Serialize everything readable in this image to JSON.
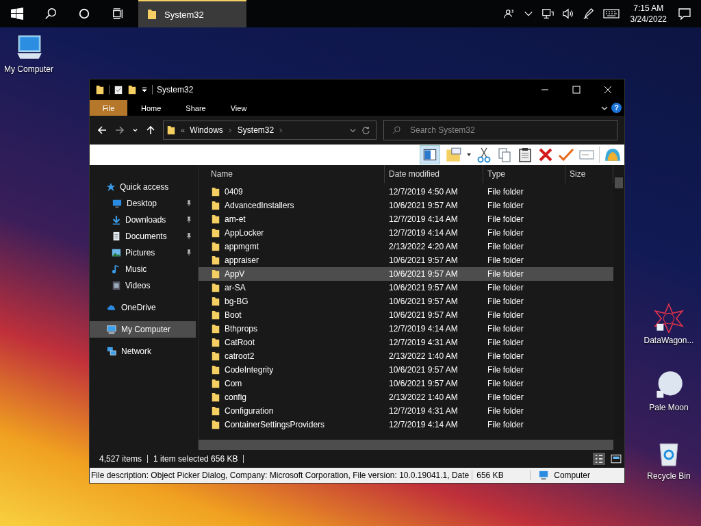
{
  "taskbar": {
    "window_button": {
      "label": "System32",
      "selected": true
    },
    "time": "7:15 AM",
    "date": "3/24/2022"
  },
  "desktop_icons": [
    {
      "label": "My Computer",
      "kind": "computer"
    },
    {
      "label": "DataWagon...",
      "kind": "star"
    },
    {
      "label": "Pale Moon",
      "kind": "moon"
    },
    {
      "label": "Recycle Bin",
      "kind": "bin"
    }
  ],
  "window": {
    "title": "System32",
    "ribbon_tabs": [
      {
        "label": "File",
        "kind": "file"
      },
      {
        "label": "Home",
        "kind": "tab"
      },
      {
        "label": "Share",
        "kind": "tab"
      },
      {
        "label": "View",
        "kind": "tab"
      }
    ],
    "help": "?",
    "address": {
      "overflow": "«",
      "crumbs": [
        "Windows",
        "System32"
      ]
    },
    "search": {
      "placeholder": "Search System32"
    },
    "nav_pane": [
      {
        "label": "Quick access",
        "kind": "star",
        "selected": false,
        "children": [
          {
            "label": "Desktop",
            "kind": "desktop",
            "pinned": true,
            "selected": false
          },
          {
            "label": "Downloads",
            "kind": "download",
            "pinned": true,
            "selected": false
          },
          {
            "label": "Documents",
            "kind": "document",
            "pinned": true,
            "selected": false
          },
          {
            "label": "Pictures",
            "kind": "picture",
            "pinned": true,
            "selected": false
          },
          {
            "label": "Music",
            "kind": "music",
            "pinned": false,
            "selected": false
          },
          {
            "label": "Videos",
            "kind": "video",
            "pinned": false,
            "selected": false
          }
        ]
      },
      {
        "label": "OneDrive",
        "kind": "cloud",
        "selected": false
      },
      {
        "label": "My Computer",
        "kind": "computer",
        "selected": true
      },
      {
        "label": "Network",
        "kind": "network",
        "selected": false
      }
    ],
    "columns": [
      "Name",
      "Date modified",
      "Type",
      "Size"
    ],
    "rows": [
      {
        "name": "0409",
        "date": "12/7/2019 4:50 AM",
        "type": "File folder",
        "selected": false
      },
      {
        "name": "AdvancedInstallers",
        "date": "10/6/2021 9:57 AM",
        "type": "File folder",
        "selected": false
      },
      {
        "name": "am-et",
        "date": "12/7/2019 4:14 AM",
        "type": "File folder",
        "selected": false
      },
      {
        "name": "AppLocker",
        "date": "12/7/2019 4:14 AM",
        "type": "File folder",
        "selected": false
      },
      {
        "name": "appmgmt",
        "date": "2/13/2022 4:20 AM",
        "type": "File folder",
        "selected": false
      },
      {
        "name": "appraiser",
        "date": "10/6/2021 9:57 AM",
        "type": "File folder",
        "selected": false
      },
      {
        "name": "AppV",
        "date": "10/6/2021 9:57 AM",
        "type": "File folder",
        "selected": true
      },
      {
        "name": "ar-SA",
        "date": "10/6/2021 9:57 AM",
        "type": "File folder",
        "selected": false
      },
      {
        "name": "bg-BG",
        "date": "10/6/2021 9:57 AM",
        "type": "File folder",
        "selected": false
      },
      {
        "name": "Boot",
        "date": "10/6/2021 9:57 AM",
        "type": "File folder",
        "selected": false
      },
      {
        "name": "Bthprops",
        "date": "12/7/2019 4:14 AM",
        "type": "File folder",
        "selected": false
      },
      {
        "name": "CatRoot",
        "date": "12/7/2019 4:31 AM",
        "type": "File folder",
        "selected": false
      },
      {
        "name": "catroot2",
        "date": "2/13/2022 1:40 AM",
        "type": "File folder",
        "selected": false
      },
      {
        "name": "CodeIntegrity",
        "date": "10/6/2021 9:57 AM",
        "type": "File folder",
        "selected": false
      },
      {
        "name": "Com",
        "date": "10/6/2021 9:57 AM",
        "type": "File folder",
        "selected": false
      },
      {
        "name": "config",
        "date": "2/13/2022 1:40 AM",
        "type": "File folder",
        "selected": false
      },
      {
        "name": "Configuration",
        "date": "12/7/2019 4:31 AM",
        "type": "File folder",
        "selected": false
      },
      {
        "name": "ContainerSettingsProviders",
        "date": "12/7/2019 4:14 AM",
        "type": "File folder",
        "selected": false
      }
    ],
    "status_bar": {
      "count": "4,527 items",
      "selection": "1 item selected  656 KB"
    },
    "details_bar": {
      "description": "File description: Object Picker Dialog, Company: Microsoft Corporation, File version: 10.0.19041.1, Date",
      "size": "656 KB",
      "location": "Computer"
    }
  }
}
